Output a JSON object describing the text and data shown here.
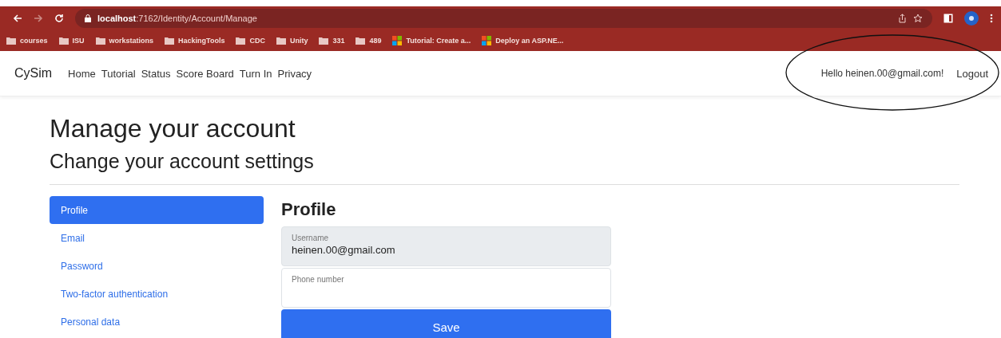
{
  "browser": {
    "url_host": "localhost",
    "url_path": ":7162/Identity/Account/Manage",
    "bookmarks": [
      {
        "kind": "folder",
        "label": "courses"
      },
      {
        "kind": "folder",
        "label": "ISU"
      },
      {
        "kind": "folder",
        "label": "workstations"
      },
      {
        "kind": "folder",
        "label": "HackingTools"
      },
      {
        "kind": "folder",
        "label": "CDC"
      },
      {
        "kind": "folder",
        "label": "Unity"
      },
      {
        "kind": "folder",
        "label": "331"
      },
      {
        "kind": "folder",
        "label": "489"
      },
      {
        "kind": "site",
        "label": "Tutorial: Create a..."
      },
      {
        "kind": "site",
        "label": "Deploy an ASP.NE..."
      }
    ]
  },
  "navbar": {
    "brand": "CySim",
    "links": [
      "Home",
      "Tutorial",
      "Status",
      "Score Board",
      "Turn In",
      "Privacy"
    ],
    "greeting": "Hello heinen.00@gmail.com!",
    "logout": "Logout"
  },
  "page": {
    "title": "Manage your account",
    "subtitle": "Change your account settings"
  },
  "sidebar": {
    "items": [
      {
        "label": "Profile",
        "selected": true
      },
      {
        "label": "Email",
        "selected": false
      },
      {
        "label": "Password",
        "selected": false
      },
      {
        "label": "Two-factor authentication",
        "selected": false
      },
      {
        "label": "Personal data",
        "selected": false
      }
    ]
  },
  "profile": {
    "heading": "Profile",
    "fields": [
      {
        "label": "Username",
        "value": "heinen.00@gmail.com",
        "disabled": true
      },
      {
        "label": "Phone number",
        "disabled": false
      }
    ],
    "save": "Save"
  }
}
